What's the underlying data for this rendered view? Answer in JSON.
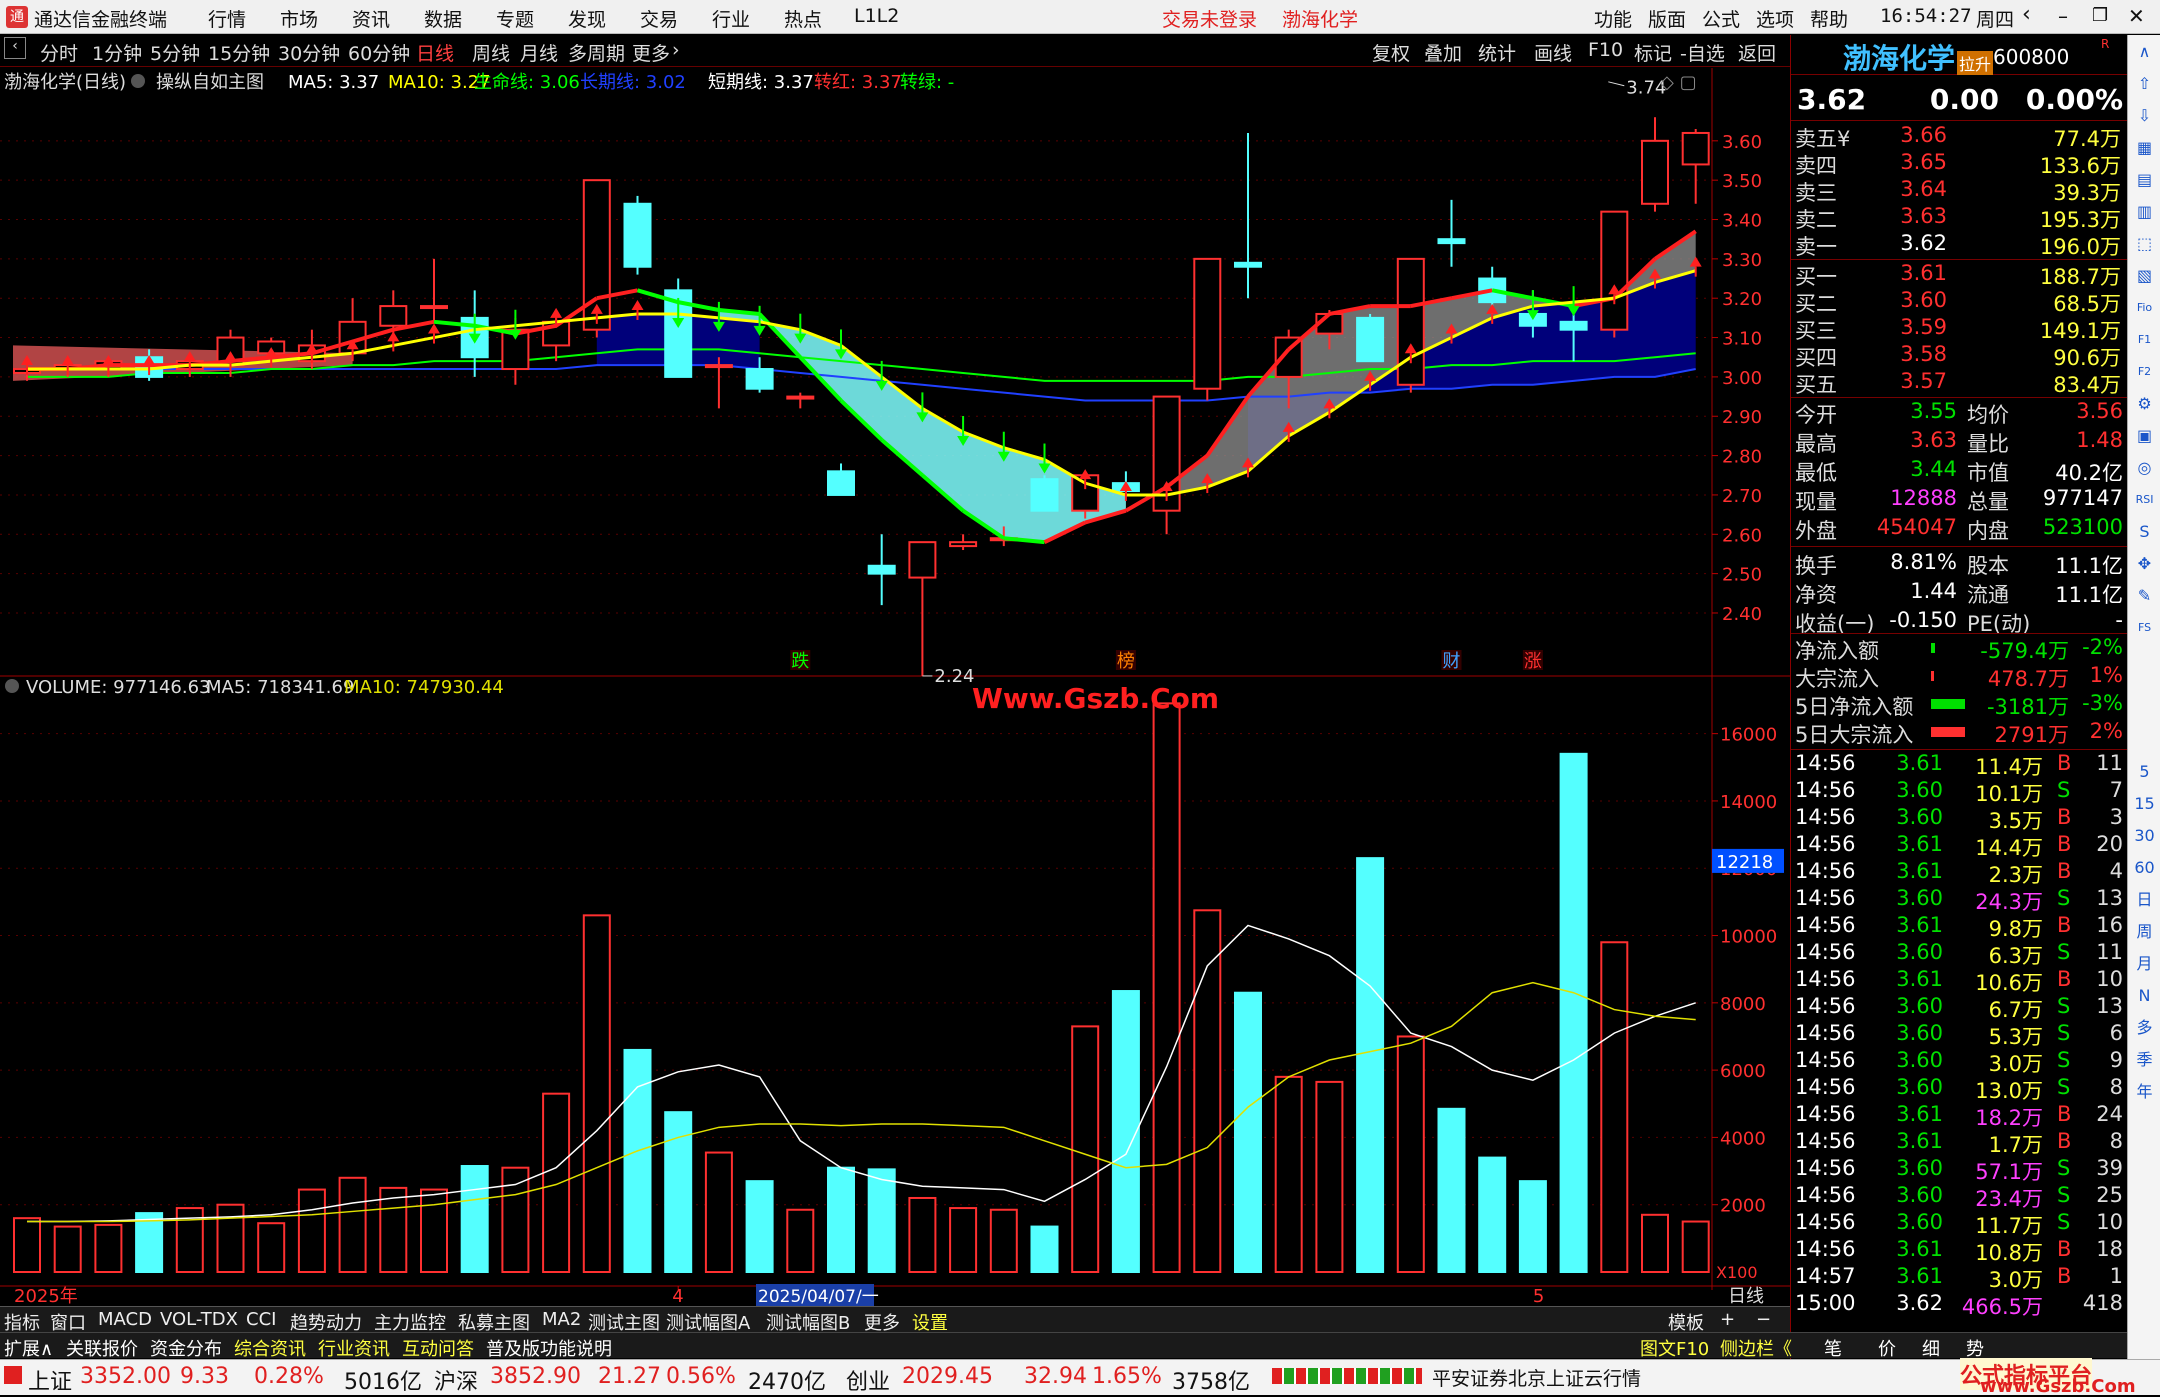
{
  "app": {
    "name": "通达信金融终端",
    "menu": [
      "行情",
      "市场",
      "资讯",
      "数据",
      "专题",
      "发现",
      "交易",
      "行业",
      "热点",
      "L1L2"
    ],
    "login_status": "交易未登录",
    "stock_name": "渤海化学",
    "right_menu": [
      "功能",
      "版面",
      "公式",
      "选项",
      "帮助"
    ],
    "time": "16:54:27",
    "weekday": "周四"
  },
  "period_tabs": [
    "分时",
    "1分钟",
    "5分钟",
    "15分钟",
    "30分钟",
    "60分钟",
    "日线",
    "周线",
    "月线",
    "多周期",
    "更多"
  ],
  "active_period": "日线",
  "chart_tools": [
    "复权",
    "叠加",
    "统计",
    "画线",
    "F10",
    "标记",
    "-自选",
    "返回"
  ],
  "main_chart": {
    "title": "渤海化学(日线)",
    "formula": "操纵自如主图",
    "indicators": [
      {
        "label": "MA5: 3.37",
        "color": "#ffffff"
      },
      {
        "label": "MA10: 3.27",
        "color": "#ffff00"
      },
      {
        "label": "生命线: 3.06",
        "color": "#00ff00"
      },
      {
        "label": "长期线: 3.02",
        "color": "#2040ff"
      },
      {
        "label": "短期线: 3.37",
        "color": "#ffffff"
      },
      {
        "label": "转红: 3.37",
        "color": "#ff3030"
      },
      {
        "label": "转绿: -",
        "color": "#00ff00"
      }
    ],
    "high_label": "3.74",
    "low_label": "2.24",
    "event_markers": [
      {
        "text": "跌",
        "index": 19,
        "color": "#00ff00"
      },
      {
        "text": "榜",
        "index": 27,
        "color": "#ff8000"
      },
      {
        "text": "财",
        "index": 35,
        "color": "#40a0ff"
      },
      {
        "text": "涨",
        "index": 37,
        "color": "#ff3030"
      }
    ]
  },
  "chart_data": [
    {
      "type": "candlestick",
      "ylim": [
        2.25,
        3.78
      ],
      "yticks": [
        "3.60",
        "3.50",
        "3.40",
        "3.30",
        "3.20",
        "3.10",
        "3.00",
        "2.90",
        "2.80",
        "2.70",
        "2.60",
        "2.50",
        "2.40"
      ],
      "candles": [
        {
          "o": 3.01,
          "h": 3.03,
          "l": 2.99,
          "c": 3.02
        },
        {
          "o": 3.02,
          "h": 3.04,
          "l": 3.0,
          "c": 3.03
        },
        {
          "o": 3.02,
          "h": 3.05,
          "l": 3.0,
          "c": 3.04
        },
        {
          "o": 3.05,
          "h": 3.07,
          "l": 2.99,
          "c": 3.0
        },
        {
          "o": 3.02,
          "h": 3.05,
          "l": 3.0,
          "c": 3.04
        },
        {
          "o": 3.03,
          "h": 3.12,
          "l": 3.0,
          "c": 3.1
        },
        {
          "o": 3.06,
          "h": 3.1,
          "l": 3.04,
          "c": 3.09
        },
        {
          "o": 3.04,
          "h": 3.12,
          "l": 3.02,
          "c": 3.08
        },
        {
          "o": 3.06,
          "h": 3.2,
          "l": 3.04,
          "c": 3.14
        },
        {
          "o": 3.13,
          "h": 3.22,
          "l": 3.08,
          "c": 3.18
        },
        {
          "o": 3.18,
          "h": 3.3,
          "l": 3.14,
          "c": 3.18
        },
        {
          "o": 3.15,
          "h": 3.22,
          "l": 3.0,
          "c": 3.05
        },
        {
          "o": 3.02,
          "h": 3.15,
          "l": 2.98,
          "c": 3.12
        },
        {
          "o": 3.08,
          "h": 3.17,
          "l": 3.04,
          "c": 3.14
        },
        {
          "o": 3.12,
          "h": 3.5,
          "l": 3.1,
          "c": 3.5
        },
        {
          "o": 3.44,
          "h": 3.46,
          "l": 3.26,
          "c": 3.28
        },
        {
          "o": 3.22,
          "h": 3.25,
          "l": 3.0,
          "c": 3.0
        },
        {
          "o": 3.03,
          "h": 3.05,
          "l": 2.92,
          "c": 3.03
        },
        {
          "o": 3.02,
          "h": 3.05,
          "l": 2.96,
          "c": 2.97
        },
        {
          "o": 2.95,
          "h": 2.96,
          "l": 2.92,
          "c": 2.95
        },
        {
          "o": 2.76,
          "h": 2.78,
          "l": 2.7,
          "c": 2.7
        },
        {
          "o": 2.52,
          "h": 2.6,
          "l": 2.42,
          "c": 2.5
        },
        {
          "o": 2.49,
          "h": 2.58,
          "l": 2.24,
          "c": 2.58
        },
        {
          "o": 2.57,
          "h": 2.6,
          "l": 2.56,
          "c": 2.58
        },
        {
          "o": 2.59,
          "h": 2.62,
          "l": 2.57,
          "c": 2.59
        },
        {
          "o": 2.74,
          "h": 2.75,
          "l": 2.66,
          "c": 2.66
        },
        {
          "o": 2.66,
          "h": 2.76,
          "l": 2.64,
          "c": 2.75
        },
        {
          "o": 2.73,
          "h": 2.76,
          "l": 2.7,
          "c": 2.71
        },
        {
          "o": 2.66,
          "h": 2.95,
          "l": 2.6,
          "c": 2.95
        },
        {
          "o": 2.97,
          "h": 3.3,
          "l": 2.94,
          "c": 3.3
        },
        {
          "o": 3.29,
          "h": 3.62,
          "l": 3.2,
          "c": 3.28
        },
        {
          "o": 3.0,
          "h": 3.12,
          "l": 2.92,
          "c": 3.1
        },
        {
          "o": 3.11,
          "h": 3.17,
          "l": 3.07,
          "c": 3.16
        },
        {
          "o": 3.15,
          "h": 3.16,
          "l": 3.04,
          "c": 3.04
        },
        {
          "o": 2.98,
          "h": 3.3,
          "l": 2.96,
          "c": 3.3
        },
        {
          "o": 3.35,
          "h": 3.45,
          "l": 3.28,
          "c": 3.34
        },
        {
          "o": 3.25,
          "h": 3.28,
          "l": 3.16,
          "c": 3.19
        },
        {
          "o": 3.16,
          "h": 3.22,
          "l": 3.1,
          "c": 3.13
        },
        {
          "o": 3.14,
          "h": 3.18,
          "l": 3.04,
          "c": 3.12
        },
        {
          "o": 3.12,
          "h": 3.42,
          "l": 3.1,
          "c": 3.42
        },
        {
          "o": 3.44,
          "h": 3.66,
          "l": 3.42,
          "c": 3.6
        },
        {
          "o": 3.54,
          "h": 3.63,
          "l": 3.44,
          "c": 3.62
        }
      ],
      "ma5": [
        3.02,
        3.02,
        3.03,
        3.03,
        3.03,
        3.04,
        3.05,
        3.06,
        3.09,
        3.12,
        3.14,
        3.13,
        3.11,
        3.13,
        3.2,
        3.22,
        3.19,
        3.17,
        3.16,
        3.05,
        2.94,
        2.84,
        2.75,
        2.66,
        2.59,
        2.58,
        2.63,
        2.66,
        2.72,
        2.8,
        2.95,
        3.07,
        3.16,
        3.18,
        3.18,
        3.2,
        3.22,
        3.2,
        3.18,
        3.2,
        3.3,
        3.37
      ],
      "ma10": [
        3.02,
        3.02,
        3.02,
        3.02,
        3.03,
        3.03,
        3.04,
        3.05,
        3.06,
        3.08,
        3.1,
        3.12,
        3.13,
        3.14,
        3.15,
        3.16,
        3.16,
        3.15,
        3.14,
        3.12,
        3.08,
        3.0,
        2.92,
        2.86,
        2.82,
        2.79,
        2.73,
        2.7,
        2.7,
        2.72,
        2.76,
        2.85,
        2.91,
        2.98,
        3.05,
        3.1,
        3.15,
        3.18,
        3.19,
        3.2,
        3.24,
        3.27
      ],
      "life": [
        3.0,
        3.0,
        3.0,
        3.01,
        3.01,
        3.01,
        3.02,
        3.02,
        3.03,
        3.03,
        3.04,
        3.04,
        3.04,
        3.05,
        3.06,
        3.07,
        3.07,
        3.07,
        3.06,
        3.05,
        3.04,
        3.03,
        3.02,
        3.01,
        3.0,
        2.99,
        2.99,
        2.99,
        2.99,
        2.99,
        3.0,
        3.0,
        3.01,
        3.02,
        3.02,
        3.03,
        3.03,
        3.04,
        3.04,
        3.04,
        3.05,
        3.06
      ],
      "longterm": [
        3.02,
        3.02,
        3.02,
        3.02,
        3.02,
        3.02,
        3.02,
        3.02,
        3.02,
        3.02,
        3.02,
        3.02,
        3.02,
        3.02,
        3.03,
        3.03,
        3.03,
        3.03,
        3.02,
        3.01,
        3.0,
        2.99,
        2.98,
        2.97,
        2.96,
        2.95,
        2.94,
        2.94,
        2.94,
        2.94,
        2.95,
        2.95,
        2.96,
        2.96,
        2.97,
        2.97,
        2.98,
        2.98,
        2.99,
        3.0,
        3.0,
        3.02
      ]
    },
    {
      "type": "bar",
      "title": "VOLUME: 977146.63",
      "ma5_label": "MA5: 718341.69",
      "ma10_label": "MA10: 747930.44",
      "ylim": [
        0,
        17000
      ],
      "yticks": [
        "16000",
        "14000",
        "12000",
        "10000",
        "8000",
        "6000",
        "4000",
        "2000"
      ],
      "unit": "X100",
      "current_label": "12218",
      "values": [
        1600,
        1350,
        1400,
        1750,
        1900,
        2000,
        1450,
        2450,
        2800,
        2500,
        2450,
        3150,
        3100,
        5300,
        10600,
        6600,
        4750,
        3550,
        2700,
        1850,
        3100,
        3050,
        2200,
        1900,
        1850,
        1350,
        7300,
        8350,
        16900,
        10750,
        8300,
        5800,
        5650,
        12300,
        7000,
        4850,
        3400,
        2700,
        15400,
        9800,
        1700,
        1500
      ],
      "ma5": [
        1500,
        1500,
        1520,
        1560,
        1600,
        1640,
        1700,
        1850,
        2050,
        2200,
        2300,
        2450,
        2600,
        3100,
        4200,
        5500,
        5950,
        6150,
        5800,
        3900,
        3100,
        2750,
        2550,
        2500,
        2450,
        2100,
        2750,
        3500,
        6100,
        9100,
        10300,
        9900,
        9400,
        8500,
        7100,
        6700,
        6000,
        5700,
        6300,
        7100,
        7600,
        8000
      ],
      "ma10": [
        1500,
        1500,
        1500,
        1520,
        1550,
        1600,
        1650,
        1700,
        1800,
        1900,
        2000,
        2150,
        2300,
        2600,
        3100,
        3600,
        4000,
        4300,
        4400,
        4400,
        4350,
        4400,
        4400,
        4350,
        4300,
        3900,
        3500,
        3100,
        3200,
        3700,
        4900,
        5800,
        6300,
        6550,
        6800,
        7300,
        8300,
        8600,
        8300,
        7800,
        7600,
        7500
      ]
    }
  ],
  "xaxis": {
    "start_label": "2025年",
    "mid_label": "4",
    "cursor_label": "2025/04/07/一",
    "end_label": "5",
    "period": "日线"
  },
  "watermark": "Www.Gszb.Com",
  "quote": {
    "name": "渤海化学",
    "badge": "拉升",
    "code": "600800",
    "price": "3.62",
    "change": "0.00",
    "change_pct": "0.00%",
    "asks": [
      {
        "label": "卖五",
        "price": "3.66",
        "vol": "77.4万"
      },
      {
        "label": "卖四",
        "price": "3.65",
        "vol": "133.6万"
      },
      {
        "label": "卖三",
        "price": "3.64",
        "vol": "39.3万"
      },
      {
        "label": "卖二",
        "price": "3.63",
        "vol": "195.3万"
      },
      {
        "label": "卖一",
        "price": "3.62",
        "vol": "196.0万"
      }
    ],
    "bids": [
      {
        "label": "买一",
        "price": "3.61",
        "vol": "188.7万"
      },
      {
        "label": "买二",
        "price": "3.60",
        "vol": "68.5万"
      },
      {
        "label": "买三",
        "price": "3.59",
        "vol": "149.1万"
      },
      {
        "label": "买四",
        "price": "3.58",
        "vol": "90.6万"
      },
      {
        "label": "买五",
        "price": "3.57",
        "vol": "83.4万"
      }
    ],
    "stats": [
      [
        "今开",
        "3.55",
        "均价",
        "3.56"
      ],
      [
        "最高",
        "3.63",
        "量比",
        "1.48"
      ],
      [
        "最低",
        "3.44",
        "市值",
        "40.2亿"
      ],
      [
        "现量",
        "12888",
        "总量",
        "977147"
      ],
      [
        "外盘",
        "454047",
        "内盘",
        "523100"
      ],
      [
        "换手",
        "8.81%",
        "股本",
        "11.1亿"
      ],
      [
        "净资",
        "1.44",
        "流通",
        "11.1亿"
      ],
      [
        "收益(一)",
        "-0.150",
        "PE(动)",
        "-"
      ]
    ],
    "flows": [
      {
        "label": "净流入额",
        "value": "-579.4万",
        "pct": "-2%"
      },
      {
        "label": "大宗流入",
        "value": "478.7万",
        "pct": "1%"
      },
      {
        "label": "5日净流入额",
        "value": "-3181万",
        "pct": "-3%"
      },
      {
        "label": "5日大宗流入",
        "value": "2791万",
        "pct": "2%"
      }
    ],
    "ticks": [
      [
        "14:56",
        "3.61",
        "11.4万",
        "B",
        "11"
      ],
      [
        "14:56",
        "3.60",
        "10.1万",
        "S",
        "7"
      ],
      [
        "14:56",
        "3.60",
        "3.5万",
        "B",
        "3"
      ],
      [
        "14:56",
        "3.61",
        "14.4万",
        "B",
        "20"
      ],
      [
        "14:56",
        "3.61",
        "2.3万",
        "B",
        "4"
      ],
      [
        "14:56",
        "3.60",
        "24.3万",
        "S",
        "13"
      ],
      [
        "14:56",
        "3.61",
        "9.8万",
        "B",
        "16"
      ],
      [
        "14:56",
        "3.60",
        "6.3万",
        "S",
        "11"
      ],
      [
        "14:56",
        "3.61",
        "10.6万",
        "B",
        "10"
      ],
      [
        "14:56",
        "3.60",
        "6.7万",
        "S",
        "13"
      ],
      [
        "14:56",
        "3.60",
        "5.3万",
        "S",
        "6"
      ],
      [
        "14:56",
        "3.60",
        "3.0万",
        "S",
        "9"
      ],
      [
        "14:56",
        "3.60",
        "13.0万",
        "S",
        "8"
      ],
      [
        "14:56",
        "3.61",
        "18.2万",
        "B",
        "24"
      ],
      [
        "14:56",
        "3.61",
        "1.7万",
        "B",
        "8"
      ],
      [
        "14:56",
        "3.60",
        "57.1万",
        "S",
        "39"
      ],
      [
        "14:56",
        "3.60",
        "23.4万",
        "S",
        "25"
      ],
      [
        "14:56",
        "3.60",
        "11.7万",
        "S",
        "10"
      ],
      [
        "14:56",
        "3.61",
        "10.8万",
        "B",
        "18"
      ],
      [
        "14:57",
        "3.61",
        "3.0万",
        "B",
        "1"
      ],
      [
        "15:00",
        "3.62",
        "466.5万",
        "",
        "418"
      ]
    ]
  },
  "bottom_tabs1": [
    "指标",
    "窗口",
    "MACD",
    "VOL-TDX",
    "CCI",
    "趋势动力",
    "主力监控",
    "私募主图",
    "MA2",
    "测试主图",
    "测试幅图A",
    "测试幅图B",
    "更多",
    "设置"
  ],
  "bottom_tabs1_right": "模板",
  "bottom_tabs2": [
    "扩展∧",
    "关联报价",
    "资金分布",
    "综合资讯",
    "行业资讯",
    "互动问答",
    "普及版功能说明"
  ],
  "bottom_tabs2_right": [
    "图文F10",
    "侧边栏《",
    "笔",
    "价",
    "细",
    "势"
  ],
  "status": {
    "indices": [
      {
        "name": "上证",
        "value": "3352.00",
        "chg": "9.33",
        "pct": "0.28%",
        "amt": "5016亿"
      },
      {
        "name": "沪深",
        "value": "3852.90",
        "chg": "21.27",
        "pct": "0.56%",
        "amt": "2470亿"
      },
      {
        "name": "创业",
        "value": "2029.45",
        "chg": "32.94",
        "pct": "1.65%",
        "amt": "3758亿"
      }
    ],
    "server": "平安证券北京上证云行情",
    "brand": "公式指标平台",
    "brand_url": "www.Gszb.Com"
  },
  "sidebar_icons": [
    "up-arrow-icon",
    "down-arrow-icon",
    "chart-icon",
    "grid-icon",
    "kline-icon",
    "list-icon",
    "f10-icon",
    "rsi-icon",
    "s-icon",
    "move-icon",
    "pen-icon",
    "fs-icon"
  ],
  "period_sidebar": [
    "5",
    "15",
    "30",
    "60",
    "日",
    "周",
    "月",
    "N",
    "多",
    "季",
    "年"
  ]
}
